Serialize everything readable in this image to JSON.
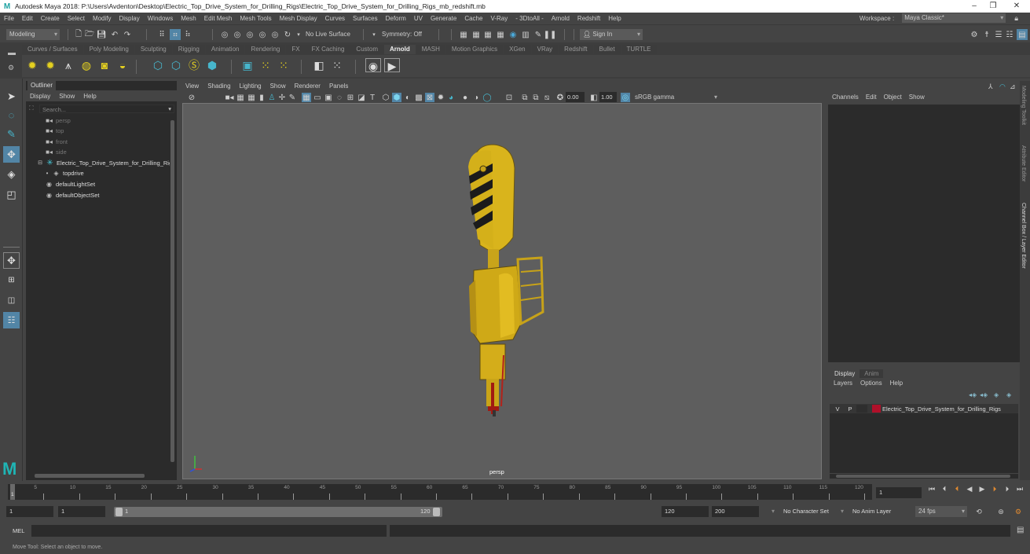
{
  "window": {
    "title": "Autodesk Maya 2018: P:\\Users\\Avdenton\\Desktop\\Electric_Top_Drive_System_for_Drilling_Rigs\\Electric_Top_Drive_System_for_Drilling_Rigs_mb_redshift.mb",
    "minimize": "–",
    "maximize": "❐",
    "close": "✕"
  },
  "menubar": [
    "File",
    "Edit",
    "Create",
    "Select",
    "Modify",
    "Display",
    "Windows",
    "Mesh",
    "Edit Mesh",
    "Mesh Tools",
    "Mesh Display",
    "Curves",
    "Surfaces",
    "Deform",
    "UV",
    "Generate",
    "Cache",
    "V-Ray",
    "- 3DtoAll -",
    "Arnold",
    "Redshift",
    "Help"
  ],
  "workspace": {
    "label": "Workspace :",
    "value": "Maya Classic*"
  },
  "statusline": {
    "mode": "Modeling",
    "live_surface": "No Live Surface",
    "symmetry": "Symmetry: Off",
    "sign_in": "Sign In"
  },
  "shelf": {
    "tabs": [
      "Curves / Surfaces",
      "Poly Modeling",
      "Sculpting",
      "Rigging",
      "Animation",
      "Rendering",
      "FX",
      "FX Caching",
      "Custom",
      "Arnold",
      "MASH",
      "Motion Graphics",
      "XGen",
      "VRay",
      "Redshift",
      "Bullet",
      "TURTLE"
    ],
    "active_tab": "Arnold"
  },
  "outliner": {
    "tab": "Outliner",
    "menu": [
      "Display",
      "Show",
      "Help"
    ],
    "search_placeholder": "Search...",
    "items": [
      {
        "label": "persp",
        "icon": "camera-icon",
        "dim": true
      },
      {
        "label": "top",
        "icon": "camera-icon",
        "dim": true
      },
      {
        "label": "front",
        "icon": "camera-icon",
        "dim": true
      },
      {
        "label": "side",
        "icon": "camera-icon",
        "dim": true
      },
      {
        "label": "Electric_Top_Drive_System_for_Drilling_Rigs",
        "icon": "group-icon",
        "dim": false
      },
      {
        "label": "topdrive",
        "icon": "mesh-icon",
        "dim": false
      },
      {
        "label": "defaultLightSet",
        "icon": "set-icon",
        "dim": false
      },
      {
        "label": "defaultObjectSet",
        "icon": "set-icon",
        "dim": false
      }
    ]
  },
  "viewport": {
    "menu": [
      "View",
      "Shading",
      "Lighting",
      "Show",
      "Renderer",
      "Panels"
    ],
    "exposure": "0.00",
    "gamma": "1.00",
    "color_space": "sRGB gamma",
    "camera_label": "persp"
  },
  "channelbox": {
    "menu": [
      "Channels",
      "Edit",
      "Object",
      "Show"
    ]
  },
  "layers": {
    "tabs": [
      "Display",
      "Anim"
    ],
    "active_tab": "Display",
    "menu": [
      "Layers",
      "Options",
      "Help"
    ],
    "rows": [
      {
        "v": "V",
        "p": "P",
        "name": "Electric_Top_Drive_System_for_Drilling_Rigs",
        "color": "#b0102a"
      }
    ]
  },
  "side_tabs": [
    "Modeling Toolkit",
    "Attribute Editor",
    "Channel Box / Layer Editor"
  ],
  "timeline": {
    "ticks": [
      5,
      10,
      15,
      20,
      25,
      30,
      35,
      40,
      45,
      50,
      55,
      60,
      65,
      70,
      75,
      80,
      85,
      90,
      95,
      100,
      105,
      110,
      115,
      120
    ],
    "current_frame_marker": "1",
    "current_frame": "1",
    "range_start": "1",
    "playback_start": "1",
    "slider_start": "1",
    "slider_end": "120",
    "playback_end": "120",
    "range_end": "200",
    "character_set": "No Character Set",
    "anim_layer": "No Anim Layer",
    "fps": "24 fps"
  },
  "command": {
    "label": "MEL",
    "help_text": "Move Tool: Select an object to move."
  }
}
